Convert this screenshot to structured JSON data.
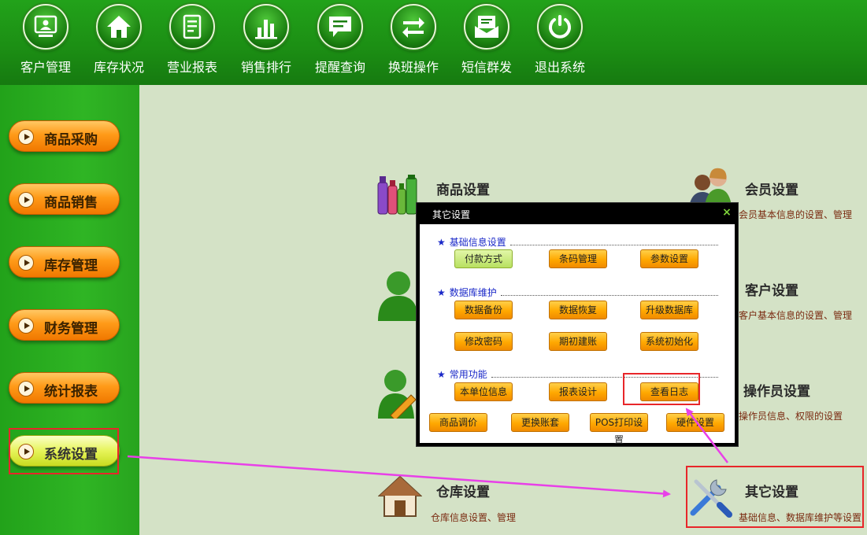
{
  "toolbar": {
    "items": [
      {
        "label": "客户管理",
        "icon": "customer-screen-icon"
      },
      {
        "label": "库存状况",
        "icon": "home-icon"
      },
      {
        "label": "营业报表",
        "icon": "report-icon"
      },
      {
        "label": "销售排行",
        "icon": "bar-chart-icon"
      },
      {
        "label": "提醒查询",
        "icon": "message-icon"
      },
      {
        "label": "换班操作",
        "icon": "swap-arrows-icon"
      },
      {
        "label": "短信群发",
        "icon": "mail-icon"
      },
      {
        "label": "退出系统",
        "icon": "power-icon"
      }
    ]
  },
  "sidebar": {
    "items": [
      {
        "label": "商品采购"
      },
      {
        "label": "商品销售"
      },
      {
        "label": "库存管理"
      },
      {
        "label": "财务管理"
      },
      {
        "label": "统计报表"
      },
      {
        "label": "系统设置",
        "active": true
      }
    ]
  },
  "modules": {
    "product": {
      "title": "商品设置"
    },
    "member": {
      "title": "会员设置",
      "desc": "会员基本信息的设置、管理"
    },
    "customer": {
      "title": "客户设置",
      "desc": "客户基本信息的设置、管理"
    },
    "operator": {
      "title": "操作员设置",
      "desc": "操作员信息、权限的设置"
    },
    "warehouse": {
      "title": "仓库设置",
      "desc": "仓库信息设置、管理"
    },
    "other": {
      "title": "其它设置",
      "desc": "基础信息、数据库维护等设置"
    }
  },
  "dialog": {
    "title": "其它设置",
    "close": "×",
    "sections": [
      {
        "title": "基础信息设置",
        "buttons": [
          "付款方式",
          "条码管理",
          "参数设置"
        ]
      },
      {
        "title": "数据库维护",
        "buttons": [
          "数据备份",
          "数据恢复",
          "升级数据库",
          "修改密码",
          "期初建账",
          "系统初始化"
        ]
      },
      {
        "title": "常用功能",
        "buttons": [
          "本单位信息",
          "报表设计",
          "查看日志",
          "商品调价",
          "更换账套",
          "POS打印设置",
          "硬件设置"
        ]
      }
    ]
  },
  "colors": {
    "toolbar_green": "#1c8f14",
    "panel_bg": "#d4e2c6",
    "button_orange": "#ff9a18",
    "highlight_red": "#e8262a",
    "arrow_magenta": "#e840e8"
  }
}
